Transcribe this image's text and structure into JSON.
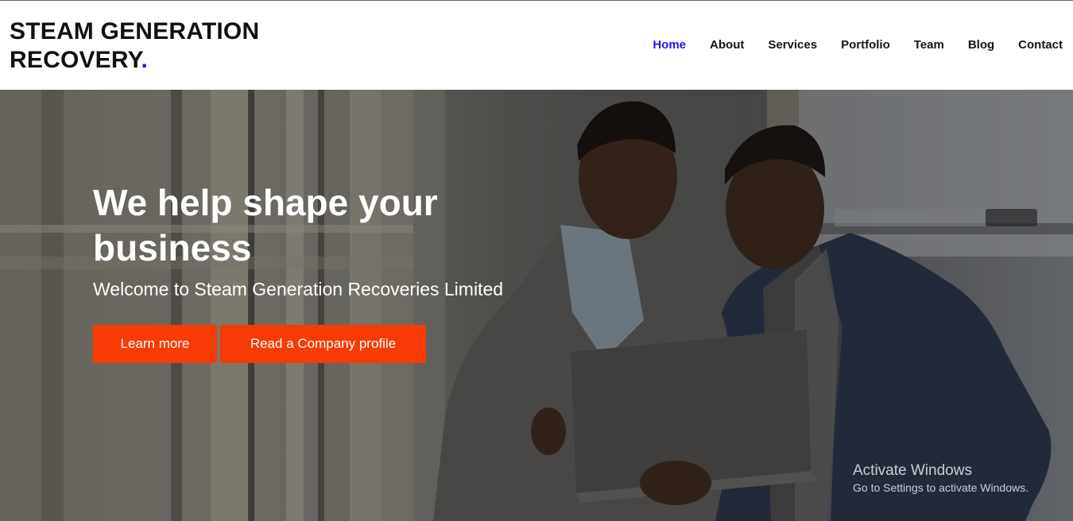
{
  "header": {
    "logo_line1": "STEAM GENERATION",
    "logo_line2": "RECOVERY",
    "logo_dot": "."
  },
  "nav": {
    "items": [
      "Home",
      "About",
      "Services",
      "Portfolio",
      "Team",
      "Blog",
      "Contact"
    ],
    "active": "Home"
  },
  "hero": {
    "title": "We help shape your business",
    "subtitle": "Welcome to Steam Generation Recoveries Limited",
    "learn_more_label": "Learn more",
    "profile_label": "Read a Company profile",
    "background_image": "two-businessmen-looking-at-laptop-photo"
  },
  "watermark": {
    "title": "Activate Windows",
    "subtitle": "Go to Settings to activate Windows."
  },
  "colors": {
    "accent_button": "#f73b05",
    "nav_active": "#1a1ae6",
    "logo_dot": "#0b2ad1"
  }
}
